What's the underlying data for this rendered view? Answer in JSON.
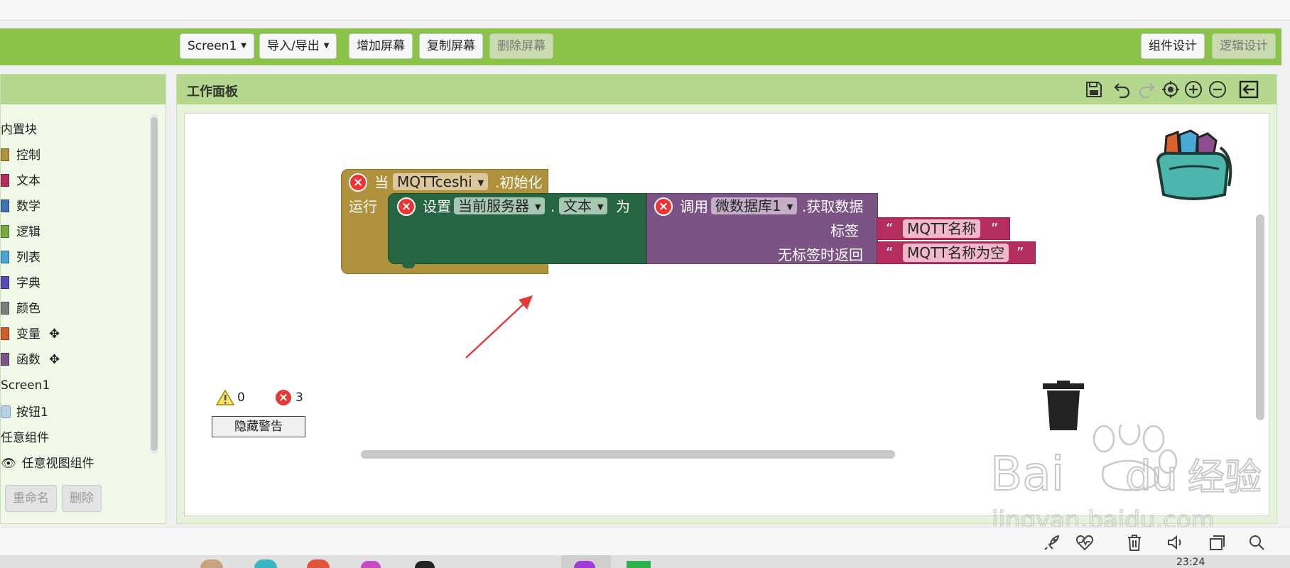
{
  "toolbar": {
    "screen_select": "Screen1",
    "import_export": "导入/导出",
    "add_screen": "增加屏幕",
    "copy_screen": "复制屏幕",
    "delete_screen": "删除屏幕",
    "designer": "组件设计",
    "blocks": "逻辑设计"
  },
  "palette": {
    "builtin_label": "内置块",
    "items": [
      {
        "label": "控制",
        "color": "#b1923c"
      },
      {
        "label": "文本",
        "color": "#b32d5e"
      },
      {
        "label": "数学",
        "color": "#3f71b5"
      },
      {
        "label": "逻辑",
        "color": "#77ab41"
      },
      {
        "label": "列表",
        "color": "#49a6d4"
      },
      {
        "label": "字典",
        "color": "#5b47b5"
      },
      {
        "label": "颜色",
        "color": "#7d7d7d"
      },
      {
        "label": "变量",
        "color": "#d05f2d"
      },
      {
        "label": "函数",
        "color": "#7c5385"
      }
    ],
    "screen_label": "Screen1",
    "button_label": "按钮1",
    "any_label": "任意组件",
    "any_view_label": "任意视图组件",
    "rename": "重命名",
    "delete": "删除"
  },
  "workspace": {
    "title": "工作面板",
    "warnings_count": "0",
    "errors_count": "3",
    "hide_warnings": "隐藏警告"
  },
  "blocks": {
    "event_when": "当",
    "event_component": "MQTTceshi",
    "event_name": ".初始化",
    "event_do": "运行",
    "set_label": "设置",
    "set_component": "当前服务器",
    "set_dot": ".",
    "set_property": "文本",
    "set_to": "为",
    "call_label": "调用",
    "call_component": "微数据库1",
    "call_method": ".获取数据",
    "arg_tag": "标签",
    "arg_default": "无标签时返回",
    "quote_open": "“",
    "quote_close": "”",
    "tag_value": "MQTT名称",
    "default_value": "MQTT名称为空"
  },
  "watermark": {
    "brand": "Bai",
    "brand2": "du",
    "cn": "经验",
    "url": "jingyan.baidu.com"
  },
  "system": {
    "clock": "23:24"
  },
  "colors": {
    "control": "#b1923c",
    "setter": "#266643",
    "procedure": "#7c5385",
    "text": "#b32d5e",
    "toolbar": "#8bc34a",
    "panel_header": "#b4d88e"
  }
}
